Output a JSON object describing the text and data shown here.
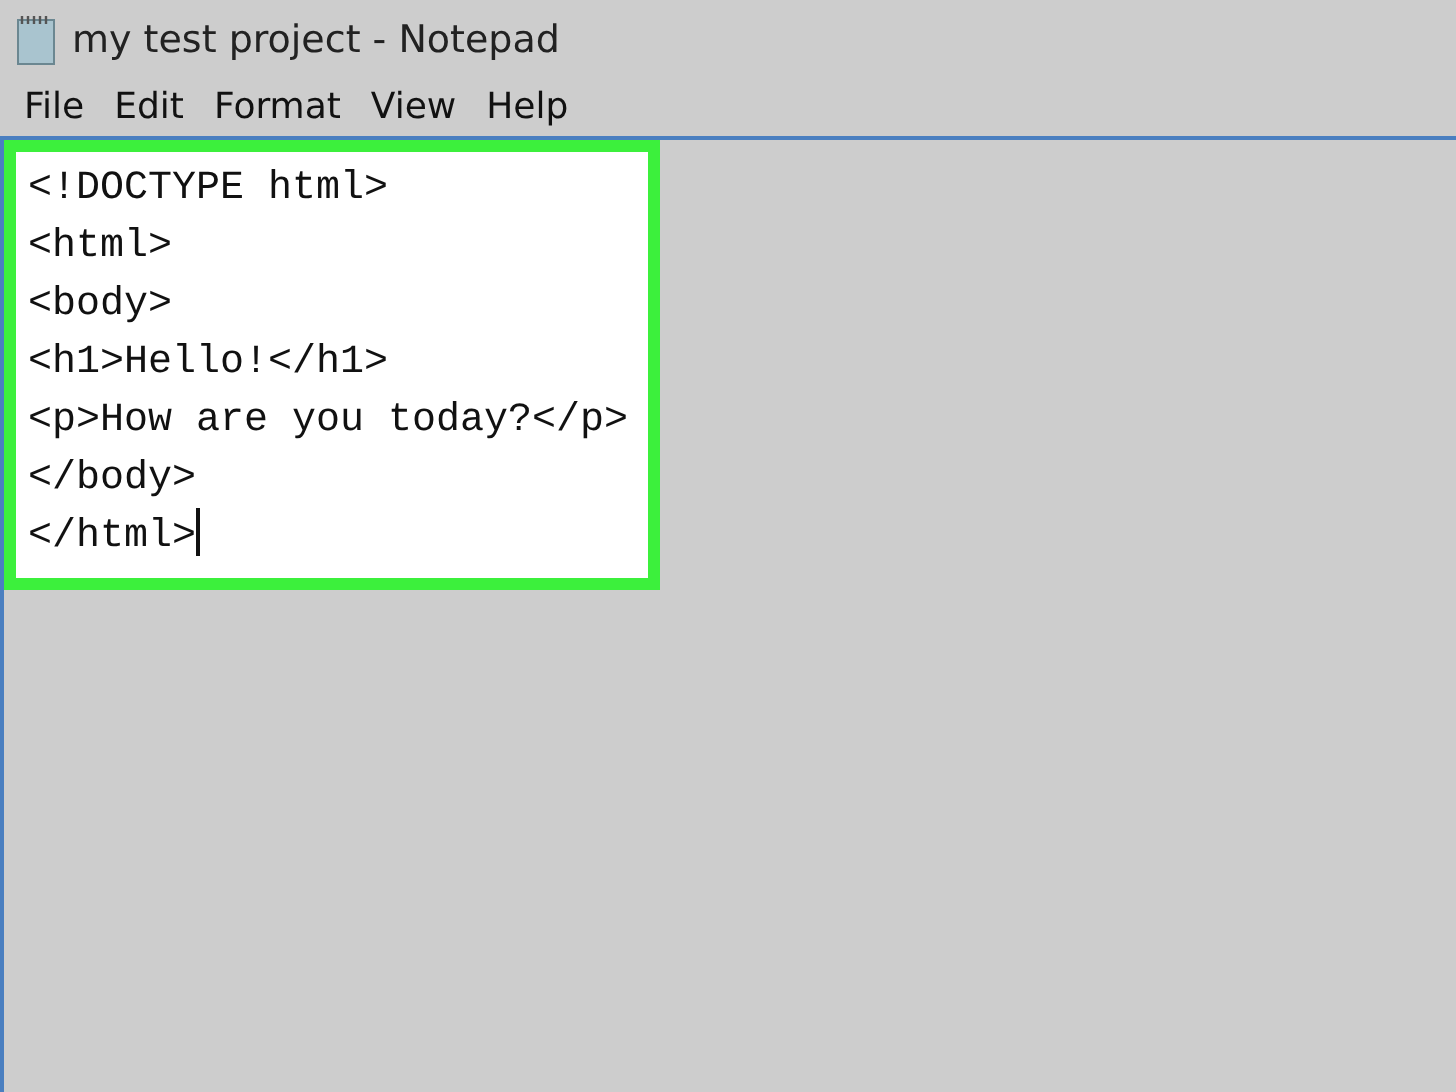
{
  "window": {
    "title": "my test project - Notepad"
  },
  "menu": [
    "File",
    "Edit",
    "Format",
    "View",
    "Help"
  ],
  "editor": {
    "lines": [
      "<!DOCTYPE html>",
      "<html>",
      "<body>",
      "<h1>Hello!</h1>",
      "<p>How are you today?</p>",
      "</body>",
      "</html>"
    ],
    "highlighted": true
  }
}
